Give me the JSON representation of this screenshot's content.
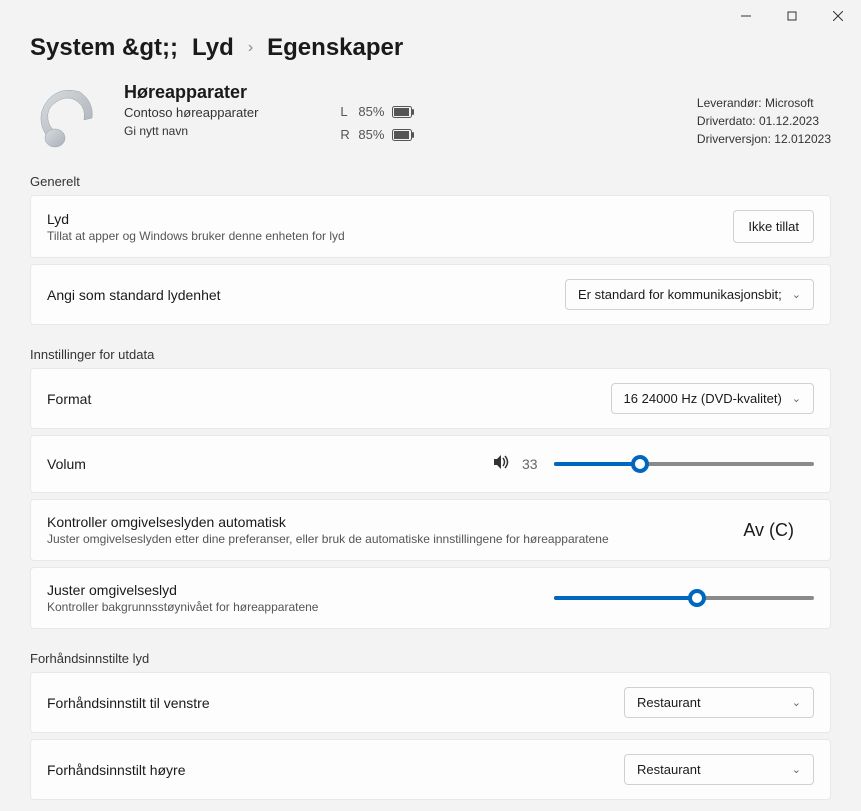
{
  "titlebar": {
    "min": "minimize",
    "max": "maximize",
    "close": "close"
  },
  "breadcrumb": {
    "system": "System &gt;;",
    "sound": "Lyd",
    "properties": "Egenskaper"
  },
  "device": {
    "title": "Høreapparater",
    "subtitle": "Contoso høreapparater",
    "rename": "Gi nytt navn",
    "battery": {
      "L": {
        "side": "L",
        "pct": "85%"
      },
      "R": {
        "side": "R",
        "pct": "85%"
      }
    }
  },
  "vendor": {
    "line1": "Leverandør: Microsoft",
    "line2": "Driverdato: 01.12.2023",
    "line3": "Driverversjon: 12.012023"
  },
  "sections": {
    "general": {
      "label": "Generelt",
      "audio": {
        "title": "Lyd",
        "subtitle": "Tillat at apper og Windows bruker denne enheten for lyd",
        "button": "Ikke tillat"
      },
      "default": {
        "title": "Angi som standard lydenhet",
        "value": "Er standard for kommunikasjonsbit;"
      }
    },
    "output": {
      "label": "Innstillinger for utdata",
      "format": {
        "title": "Format",
        "value": "16 24000 Hz (DVD-kvalitet)"
      },
      "volume": {
        "title": "Volum",
        "value": "33",
        "pct": 33
      },
      "ambientAuto": {
        "title": "Kontroller omgivelseslyden automatisk",
        "subtitle": "Juster omgivelseslyden etter dine preferanser, eller bruk de automatiske innstillingene for høreapparatene",
        "value": "Av (C)"
      },
      "ambientAdjust": {
        "title": "Juster omgivelseslyd",
        "subtitle": "Kontroller bakgrunnsstøynivået for høreapparatene",
        "pct": 55
      }
    },
    "presets": {
      "label": "Forhåndsinnstilte lyd",
      "left": {
        "title": "Forhåndsinnstilt til venstre",
        "value": "Restaurant"
      },
      "right": {
        "title": "Forhåndsinnstilt høyre",
        "value": "Restaurant"
      }
    }
  }
}
